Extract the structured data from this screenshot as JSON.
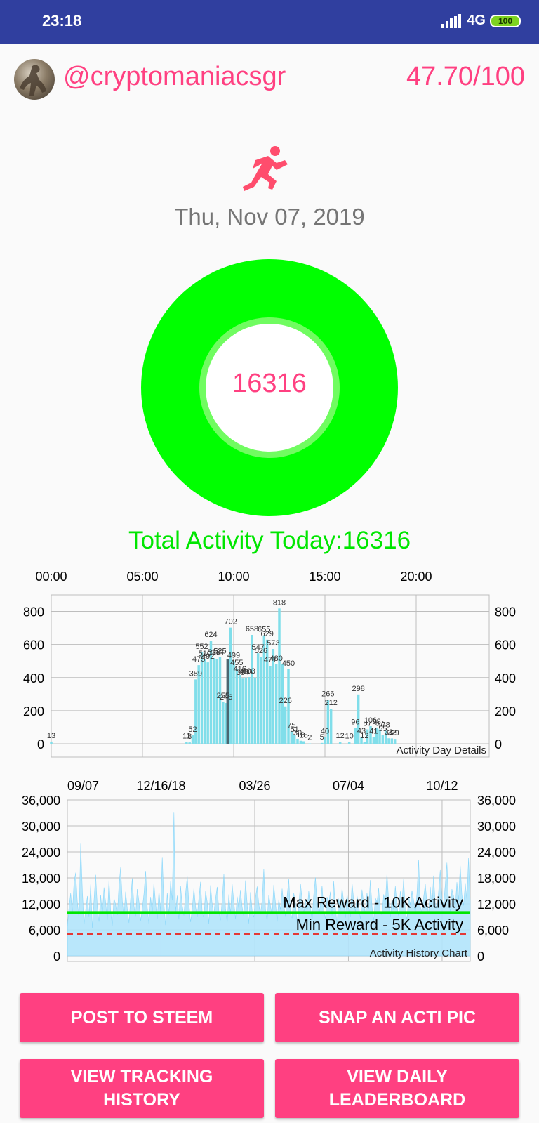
{
  "status": {
    "time": "23:18",
    "network": "4G",
    "battery": "100"
  },
  "user": {
    "handle": "@cryptomaniacsgr",
    "score": "47.70/100"
  },
  "date": "Thu, Nov 07, 2019",
  "activity": {
    "value": "16316",
    "total_text": "Total Activity Today:16316"
  },
  "colors": {
    "accent": "#ff4081",
    "ring": "#00ff00",
    "statusbar": "#303f9f",
    "bars": "#80deea"
  },
  "icons": {
    "runner": "runner-icon",
    "signal": "signal-icon"
  },
  "chart_data": [
    {
      "type": "bar",
      "title": "Activity Day Details",
      "x_tick_labels": [
        "00:00",
        "05:00",
        "10:00",
        "15:00",
        "20:00"
      ],
      "y_tick_labels": [
        "800",
        "600",
        "400",
        "200",
        "0"
      ],
      "ylim": [
        0,
        900
      ],
      "xlim": [
        0,
        288
      ],
      "grid": true,
      "highlight_index": 116,
      "points": [
        [
          0,
          13
        ],
        [
          89,
          11
        ],
        [
          91,
          8
        ],
        [
          93,
          52
        ],
        [
          95,
          389
        ],
        [
          97,
          475
        ],
        [
          99,
          552
        ],
        [
          101,
          510
        ],
        [
          103,
          492
        ],
        [
          105,
          624
        ],
        [
          107,
          518
        ],
        [
          109,
          513
        ],
        [
          111,
          525
        ],
        [
          113,
          255
        ],
        [
          115,
          246
        ],
        [
          116,
          510
        ],
        [
          118,
          702
        ],
        [
          120,
          499
        ],
        [
          122,
          455
        ],
        [
          124,
          416
        ],
        [
          126,
          394
        ],
        [
          128,
          400
        ],
        [
          130,
          403
        ],
        [
          132,
          658
        ],
        [
          134,
          400
        ],
        [
          136,
          547
        ],
        [
          138,
          526
        ],
        [
          140,
          655
        ],
        [
          142,
          629
        ],
        [
          144,
          471
        ],
        [
          146,
          573
        ],
        [
          148,
          480
        ],
        [
          150,
          818
        ],
        [
          152,
          480
        ],
        [
          154,
          226
        ],
        [
          156,
          450
        ],
        [
          158,
          75
        ],
        [
          160,
          51
        ],
        [
          162,
          30
        ],
        [
          164,
          18
        ],
        [
          166,
          15
        ],
        [
          170,
          2
        ],
        [
          178,
          5
        ],
        [
          180,
          40
        ],
        [
          182,
          266
        ],
        [
          184,
          212
        ],
        [
          190,
          12
        ],
        [
          196,
          10
        ],
        [
          200,
          96
        ],
        [
          202,
          298
        ],
        [
          204,
          43
        ],
        [
          206,
          12
        ],
        [
          208,
          87
        ],
        [
          210,
          106
        ],
        [
          212,
          41
        ],
        [
          214,
          98
        ],
        [
          216,
          87
        ],
        [
          218,
          55
        ],
        [
          220,
          78
        ],
        [
          222,
          33
        ],
        [
          224,
          32
        ],
        [
          226,
          29
        ]
      ],
      "labeled_points": [
        [
          0,
          13
        ],
        [
          89,
          11
        ],
        [
          91,
          8
        ],
        [
          93,
          52
        ],
        [
          95,
          389
        ],
        [
          97,
          475
        ],
        [
          99,
          552
        ],
        [
          101,
          510
        ],
        [
          103,
          492
        ],
        [
          105,
          624
        ],
        [
          107,
          518
        ],
        [
          109,
          513
        ],
        [
          111,
          525
        ],
        [
          113,
          255
        ],
        [
          115,
          246
        ],
        [
          118,
          702
        ],
        [
          120,
          499
        ],
        [
          122,
          455
        ],
        [
          124,
          416
        ],
        [
          126,
          394
        ],
        [
          128,
          400
        ],
        [
          130,
          403
        ],
        [
          132,
          658
        ],
        [
          136,
          547
        ],
        [
          138,
          526
        ],
        [
          140,
          655
        ],
        [
          142,
          629
        ],
        [
          144,
          471
        ],
        [
          146,
          573
        ],
        [
          148,
          480
        ],
        [
          150,
          818
        ],
        [
          156,
          450
        ],
        [
          154,
          226
        ],
        [
          158,
          75
        ],
        [
          160,
          51
        ],
        [
          162,
          30
        ],
        [
          164,
          18
        ],
        [
          166,
          15
        ],
        [
          170,
          2
        ],
        [
          178,
          5
        ],
        [
          180,
          40
        ],
        [
          182,
          266
        ],
        [
          184,
          212
        ],
        [
          190,
          12
        ],
        [
          196,
          10
        ],
        [
          200,
          96
        ],
        [
          202,
          298
        ],
        [
          204,
          43
        ],
        [
          206,
          12
        ],
        [
          208,
          87
        ],
        [
          210,
          106
        ],
        [
          212,
          41
        ],
        [
          214,
          98
        ],
        [
          216,
          87
        ],
        [
          218,
          55
        ],
        [
          220,
          78
        ],
        [
          222,
          33
        ],
        [
          224,
          32
        ],
        [
          226,
          29
        ]
      ]
    },
    {
      "type": "area",
      "title": "Activity History Chart",
      "x_tick_labels": [
        "09/07",
        "12/16/18",
        "03/26",
        "07/04",
        "10/12"
      ],
      "y_tick_labels": [
        "36,000",
        "30,000",
        "24,000",
        "18,000",
        "12,000",
        "6,000",
        "0"
      ],
      "ylim": [
        0,
        36000
      ],
      "grid": true,
      "reference_lines": [
        {
          "label": "Max Reward - 10K Activity",
          "value": 10000,
          "color": "#00e600",
          "style": "solid"
        },
        {
          "label": "Min Reward - 5K Activity",
          "value": 5000,
          "color": "#e53935",
          "style": "dashed"
        }
      ],
      "series": [
        {
          "values": [
            6800,
            11200,
            14500,
            9800,
            17000,
            19200,
            12400,
            8700,
            25900,
            15300,
            7200,
            10600,
            13800,
            9100,
            16500,
            6400,
            12900,
            18700,
            11300,
            7900,
            14100,
            9600,
            15800,
            12200,
            8300,
            17600,
            10400,
            6900,
            13300,
            11800,
            9400,
            16200,
            20400,
            12700,
            8900,
            14800,
            10900,
            7600,
            13100,
            17900,
            11500,
            9200,
            15400,
            12600,
            8100,
            10800,
            14300,
            19600,
            11100,
            7400,
            13600,
            9900,
            16800,
            12100,
            8600,
            15100,
            10300,
            22800,
            11900,
            7100,
            14600,
            9500,
            17300,
            12800,
            33200,
            10200,
            13900,
            8400,
            16100,
            11600,
            9300,
            14400,
            18300,
            12300,
            7800,
            10700,
            15600,
            11400,
            9000,
            13400,
            17100,
            10100,
            8800,
            14900,
            12500,
            7300,
            16300,
            11700,
            9700,
            13200,
            15900,
            10500,
            8200,
            12900,
            18900,
            11000,
            7700,
            14200,
            9800,
            16600,
            12400,
            8500,
            13700,
            10900,
            15200,
            11300,
            9100,
            17400,
            12000,
            7500,
            14700,
            10400,
            8900,
            13500,
            16000,
            11900,
            9600,
            12700,
            20100,
            10800,
            8000,
            14100,
            11500,
            9400,
            16400,
            12300,
            7900,
            13000,
            10600,
            15500,
            11800,
            9200,
            13800,
            17700,
            10000,
            8700,
            14500,
            12200,
            7600,
            11400,
            16700,
            13300,
            9900,
            12800,
            10300,
            15000,
            11100,
            8300,
            14000,
            18100,
            12500,
            9500,
            11600,
            16200,
            10700,
            8600,
            13600,
            12000,
            14800,
            9300,
            17200,
            11200,
            7400,
            13200,
            10500,
            15700,
            12600,
            8800,
            14300,
            11000,
            9000,
            16900,
            12900,
            10200,
            13900,
            11700,
            8500,
            15300,
            12100,
            9700,
            14600,
            10900,
            17500,
            11300,
            8100,
            13400,
            12400,
            15600,
            10100,
            9400,
            14200,
            11900,
            19100,
            12700,
            8900,
            13100,
            10800,
            16100,
            11500,
            9200,
            14900,
            12200,
            17800,
            10400,
            8400,
            13700,
            11800,
            15100,
            12800,
            9800,
            14400,
            22200,
            11400,
            10000,
            13500,
            16600,
            12300,
            9600,
            15900,
            11100,
            18500,
            12000,
            10600,
            14700,
            19800,
            13200,
            11700,
            16300,
            21500,
            12600,
            10300,
            15400,
            13800,
            11200,
            17000,
            12900,
            20800,
            14100,
            11600,
            16800,
            13000,
            22600,
            12500
          ]
        }
      ]
    }
  ],
  "buttons": {
    "post": "POST TO STEEM",
    "snap": "SNAP AN ACTI PIC",
    "history": "VIEW TRACKING\nHISTORY",
    "leaderboard": "VIEW DAILY\nLEADERBOARD"
  }
}
